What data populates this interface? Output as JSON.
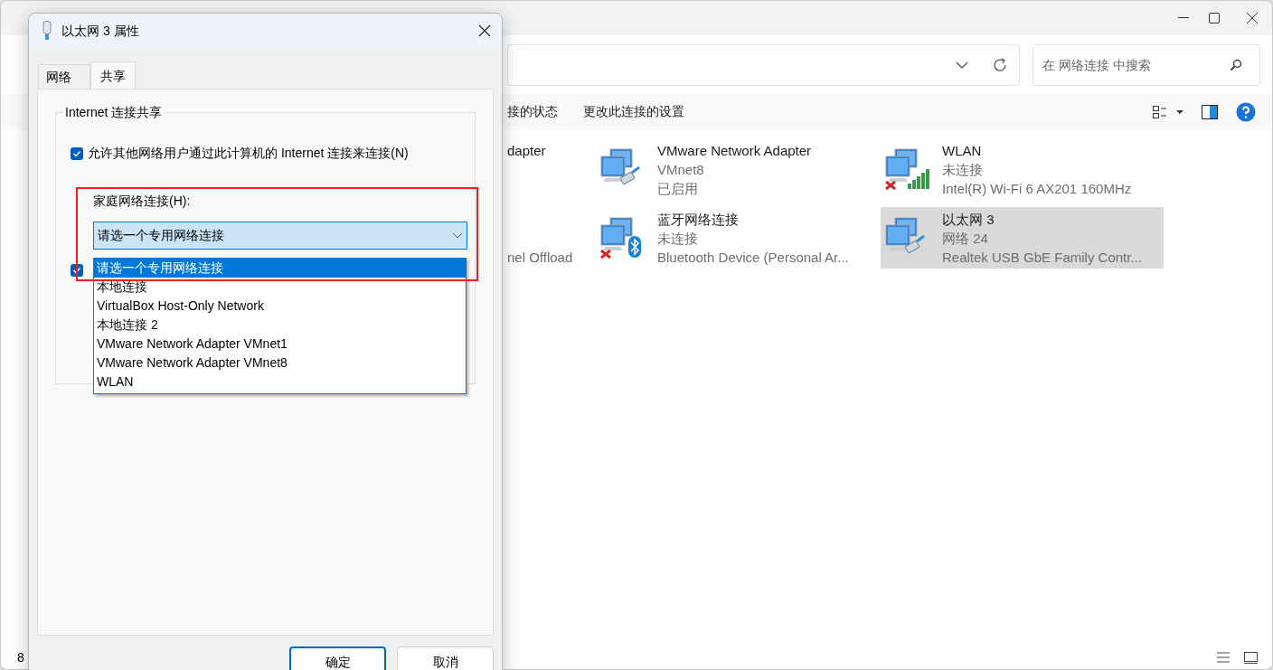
{
  "explorer": {
    "search": {
      "placeholder": "在 网络连接 中搜索"
    },
    "commands": [
      "接的状态",
      "更改此连接的设置"
    ],
    "columns": [
      [
        {
          "name": "dapter"
        },
        {
          "device": "nel Offload"
        }
      ],
      [
        {
          "name": "VMware Network Adapter",
          "status": "VMnet8",
          "device": "已启用",
          "kind": "cable",
          "disconnected": false,
          "selected": false
        },
        {
          "name": "蓝牙网络连接",
          "status": "未连接",
          "device": "Bluetooth Device (Personal Ar...",
          "kind": "bluetooth",
          "disconnected": true,
          "selected": false
        }
      ],
      [
        {
          "name": "WLAN",
          "status": "未连接",
          "device": "Intel(R) Wi-Fi 6 AX201 160MHz",
          "kind": "signal",
          "disconnected": true,
          "selected": false
        },
        {
          "name": "以太网 3",
          "status": "网络 24",
          "device": "Realtek USB GbE Family Contr...",
          "kind": "cable",
          "disconnected": false,
          "selected": true
        }
      ]
    ],
    "status_bar": {
      "count": "8"
    }
  },
  "dialog": {
    "title": "以太网 3 属性",
    "tabs": [
      {
        "label": "网络",
        "selected": false
      },
      {
        "label": "共享",
        "selected": true
      }
    ],
    "group": {
      "legend": "Internet 连接共享",
      "allow_sharing": {
        "label": "允许其他网络用户通过此计算机的 Internet 连接来连接(N)",
        "checked": true
      },
      "home_network": {
        "label": "家庭网络连接(H):",
        "value": "请选一个专用网络连接",
        "options": [
          {
            "label": "请选一个专用网络连接",
            "selected": true
          },
          {
            "label": "本地连接",
            "selected": false
          },
          {
            "label": "VirtualBox Host-Only Network",
            "selected": false
          },
          {
            "label": "本地连接 2",
            "selected": false
          },
          {
            "label": "VMware Network Adapter VMnet1",
            "selected": false
          },
          {
            "label": "VMware Network Adapter VMnet8",
            "selected": false
          },
          {
            "label": "WLAN",
            "selected": false
          }
        ]
      },
      "allow_control": {
        "checked": true
      }
    },
    "buttons": [
      "确定",
      "取消"
    ]
  }
}
